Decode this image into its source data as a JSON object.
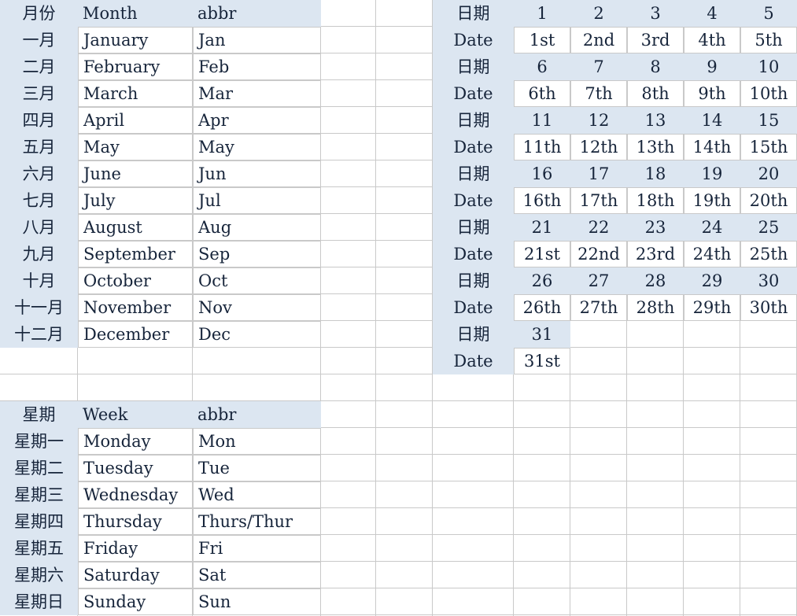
{
  "sheet": {
    "month_table": {
      "header": {
        "cjk": "月份",
        "en": "Month",
        "abbr": "abbr"
      },
      "rows": [
        {
          "cjk": "一月",
          "en": "January",
          "abbr": "Jan"
        },
        {
          "cjk": "二月",
          "en": "February",
          "abbr": "Feb"
        },
        {
          "cjk": "三月",
          "en": "March",
          "abbr": "Mar"
        },
        {
          "cjk": "四月",
          "en": "April",
          "abbr": "Apr"
        },
        {
          "cjk": "五月",
          "en": "May",
          "abbr": "May"
        },
        {
          "cjk": "六月",
          "en": "June",
          "abbr": "Jun"
        },
        {
          "cjk": "七月",
          "en": "July",
          "abbr": "Jul"
        },
        {
          "cjk": "八月",
          "en": "August",
          "abbr": "Aug"
        },
        {
          "cjk": "九月",
          "en": "September",
          "abbr": "Sep"
        },
        {
          "cjk": "十月",
          "en": "October",
          "abbr": "Oct"
        },
        {
          "cjk": "十一月",
          "en": "November",
          "abbr": "Nov"
        },
        {
          "cjk": "十二月",
          "en": "December",
          "abbr": "Dec"
        }
      ]
    },
    "week_table": {
      "header": {
        "cjk": "星期",
        "en": "Week",
        "abbr": "abbr"
      },
      "rows": [
        {
          "cjk": "星期一",
          "en": "Monday",
          "abbr": "Mon"
        },
        {
          "cjk": "星期二",
          "en": "Tuesday",
          "abbr": "Tue"
        },
        {
          "cjk": "星期三",
          "en": "Wednesday",
          "abbr": "Wed"
        },
        {
          "cjk": "星期四",
          "en": "Thursday",
          "abbr": "Thurs/Thur"
        },
        {
          "cjk": "星期五",
          "en": "Friday",
          "abbr": "Fri"
        },
        {
          "cjk": "星期六",
          "en": "Saturday",
          "abbr": "Sat"
        },
        {
          "cjk": "星期日",
          "en": "Sunday",
          "abbr": "Sun"
        }
      ]
    },
    "date_table": {
      "label_cjk": "日期",
      "label_en": "Date",
      "bands": [
        {
          "numbers": [
            "1",
            "2",
            "3",
            "4",
            "5"
          ],
          "ordinals": [
            "1st",
            "2nd",
            "3rd",
            "4th",
            "5th"
          ]
        },
        {
          "numbers": [
            "6",
            "7",
            "8",
            "9",
            "10"
          ],
          "ordinals": [
            "6th",
            "7th",
            "8th",
            "9th",
            "10th"
          ]
        },
        {
          "numbers": [
            "11",
            "12",
            "13",
            "14",
            "15"
          ],
          "ordinals": [
            "11th",
            "12th",
            "13th",
            "14th",
            "15th"
          ]
        },
        {
          "numbers": [
            "16",
            "17",
            "18",
            "19",
            "20"
          ],
          "ordinals": [
            "16th",
            "17th",
            "18th",
            "19th",
            "20th"
          ]
        },
        {
          "numbers": [
            "21",
            "22",
            "23",
            "24",
            "25"
          ],
          "ordinals": [
            "21st",
            "22nd",
            "23rd",
            "24th",
            "25th"
          ]
        },
        {
          "numbers": [
            "26",
            "27",
            "28",
            "29",
            "30"
          ],
          "ordinals": [
            "26th",
            "27th",
            "28th",
            "29th",
            "30th"
          ]
        },
        {
          "numbers": [
            "31",
            "",
            "",
            "",
            ""
          ],
          "ordinals": [
            "31st",
            "",
            "",
            "",
            ""
          ]
        }
      ]
    },
    "colors": {
      "fill": "#dce6f1",
      "gridline": "#c9c9c9",
      "text": "#16243a"
    }
  }
}
